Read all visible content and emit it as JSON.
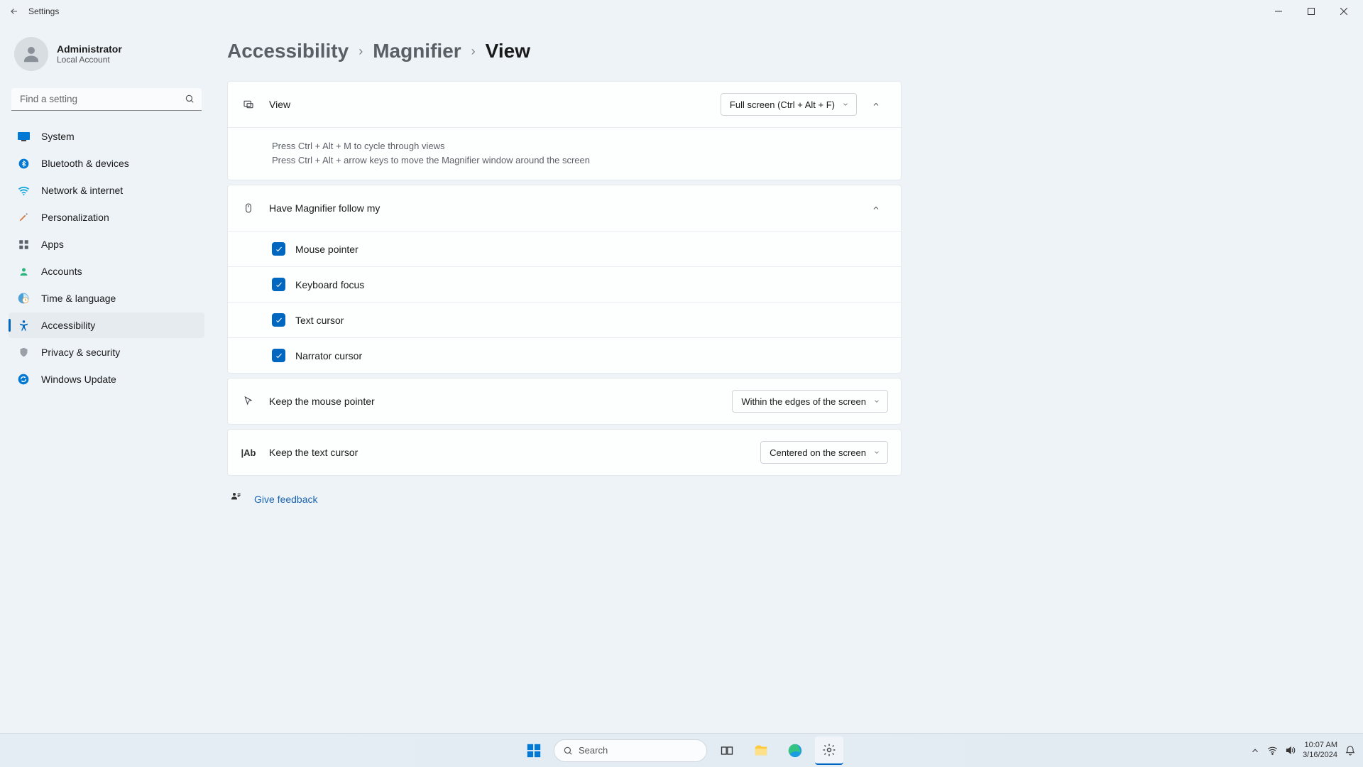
{
  "titlebar": {
    "title": "Settings"
  },
  "user": {
    "name": "Administrator",
    "sub": "Local Account"
  },
  "search": {
    "placeholder": "Find a setting"
  },
  "nav": {
    "system": "System",
    "bluetooth": "Bluetooth & devices",
    "network": "Network & internet",
    "personalization": "Personalization",
    "apps": "Apps",
    "accounts": "Accounts",
    "time": "Time & language",
    "accessibility": "Accessibility",
    "privacy": "Privacy & security",
    "update": "Windows Update"
  },
  "breadcrumb": {
    "a": "Accessibility",
    "b": "Magnifier",
    "c": "View"
  },
  "view_card": {
    "label": "View",
    "dropdown": "Full screen (Ctrl + Alt + F)",
    "info1": "Press Ctrl + Alt + M to cycle through views",
    "info2": "Press Ctrl + Alt + arrow keys to move the Magnifier window around the screen"
  },
  "follow_card": {
    "label": "Have Magnifier follow my",
    "opt1": "Mouse pointer",
    "opt2": "Keyboard focus",
    "opt3": "Text cursor",
    "opt4": "Narrator cursor"
  },
  "mouse_card": {
    "label": "Keep the mouse pointer",
    "dropdown": "Within the edges of the screen"
  },
  "textcursor_card": {
    "label": "Keep the text cursor",
    "dropdown": "Centered on the screen"
  },
  "feedback": {
    "label": "Give feedback"
  },
  "taskbar": {
    "search": "Search",
    "time": "10:07 AM",
    "date": "3/16/2024"
  }
}
